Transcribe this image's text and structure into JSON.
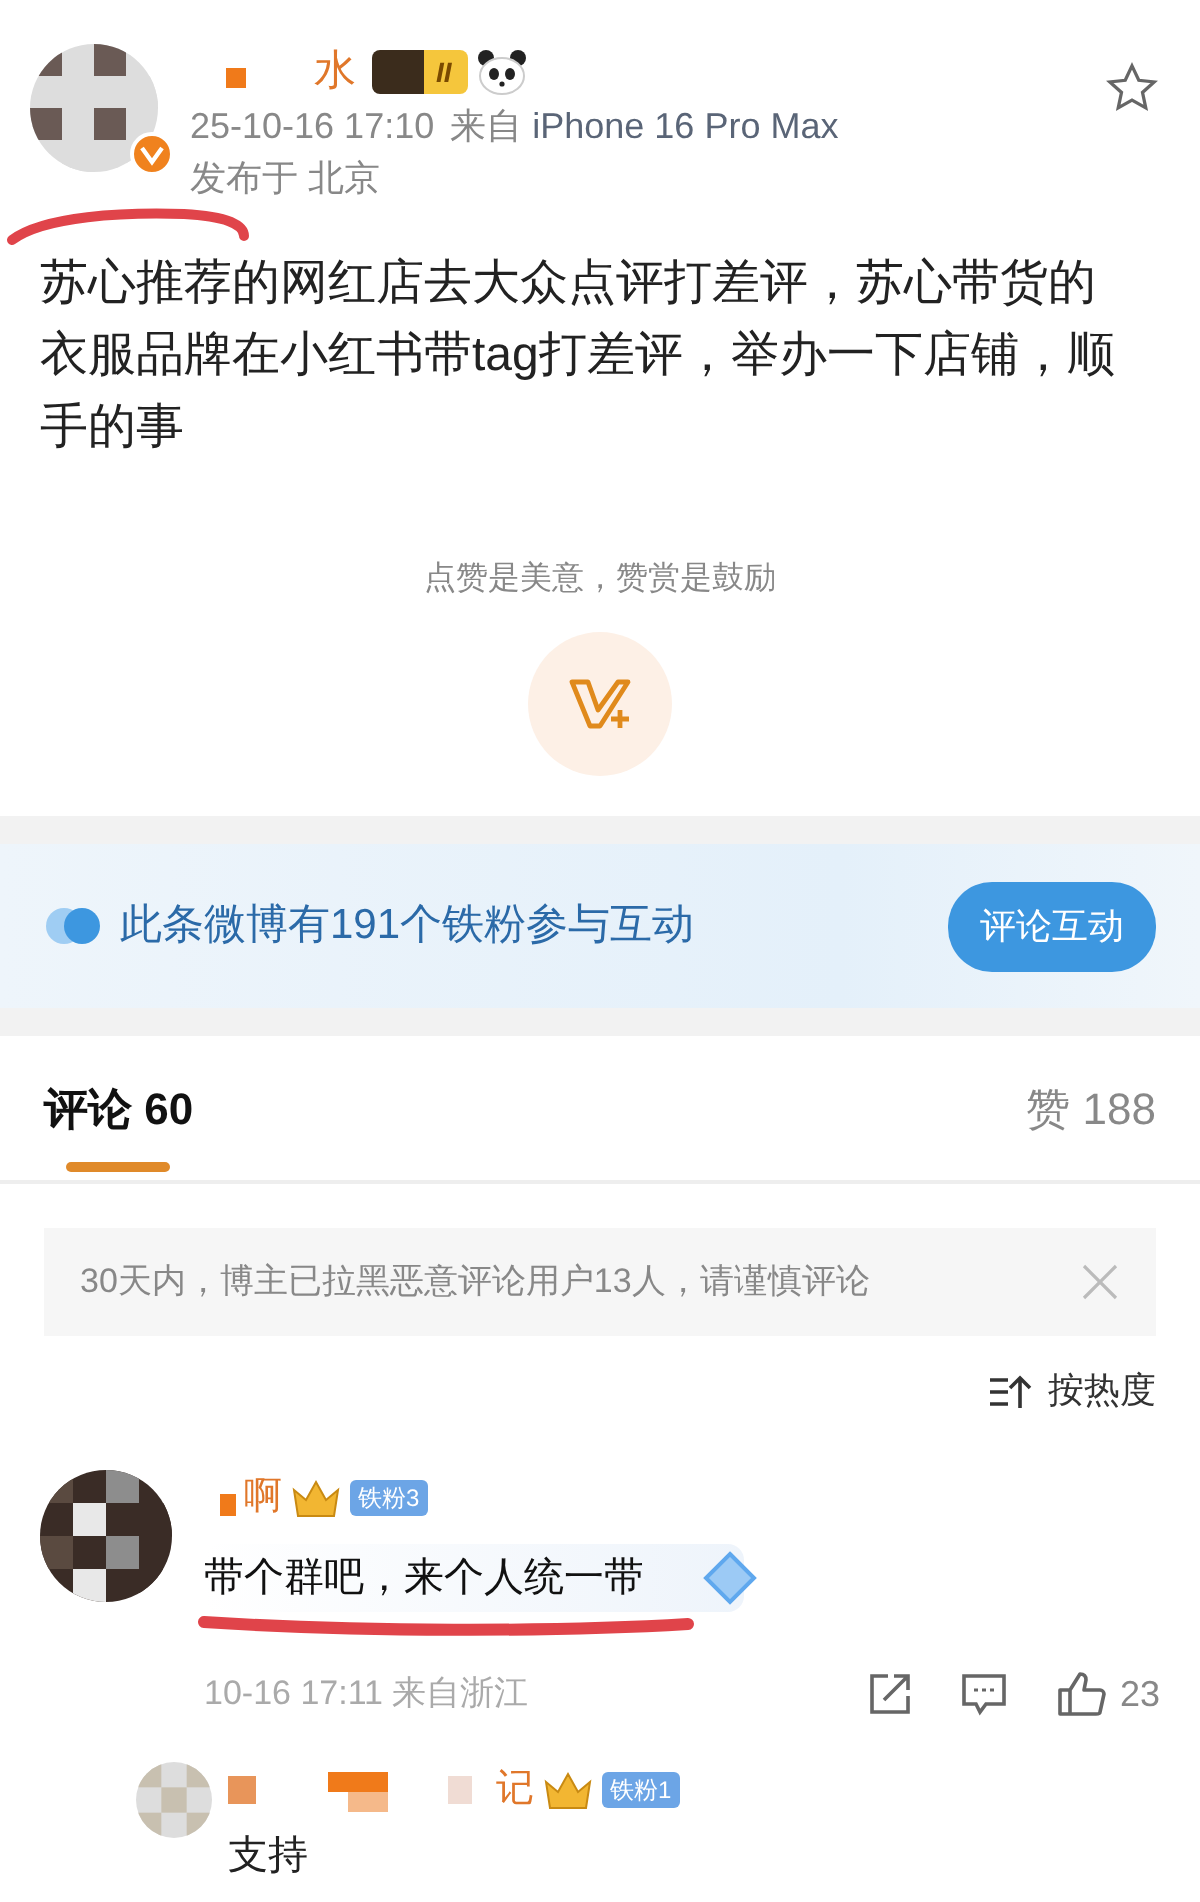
{
  "post": {
    "author": {
      "name": "水",
      "level_badge": "II"
    },
    "meta": {
      "time": "25-10-16 17:10",
      "source_prefix": "来自",
      "device": "iPhone 16 Pro Max",
      "location": "发布于 北京"
    },
    "starred": false,
    "text": "苏心推荐的网红店去大众点评打差评，苏心带货的衣服品牌在小红书带tag打差评，举办一下店铺，顺手的事",
    "reward": {
      "tip": "点赞是美意，赞赏是鼓励"
    }
  },
  "fan_banner": {
    "text": "此条微博有191个铁粉参与互动",
    "button": "评论互动"
  },
  "tabs": [
    {
      "label": "评论",
      "count": "60",
      "selected": true
    },
    {
      "label": "赞",
      "count": "188",
      "selected": false
    }
  ],
  "notice": {
    "text": "30天内，博主已拉黑恶意评论用户13人，请谨慎评论"
  },
  "sort": {
    "label": "按热度"
  },
  "comments": [
    {
      "name": "啊",
      "fan_badge": "铁粉3",
      "text": "带个群吧，来个人统一带",
      "time": "10-16 17:11 来自浙江",
      "likes": "23",
      "replies": [
        {
          "name": "记",
          "fan_badge": "铁粉1",
          "text": "支持"
        }
      ]
    }
  ]
}
